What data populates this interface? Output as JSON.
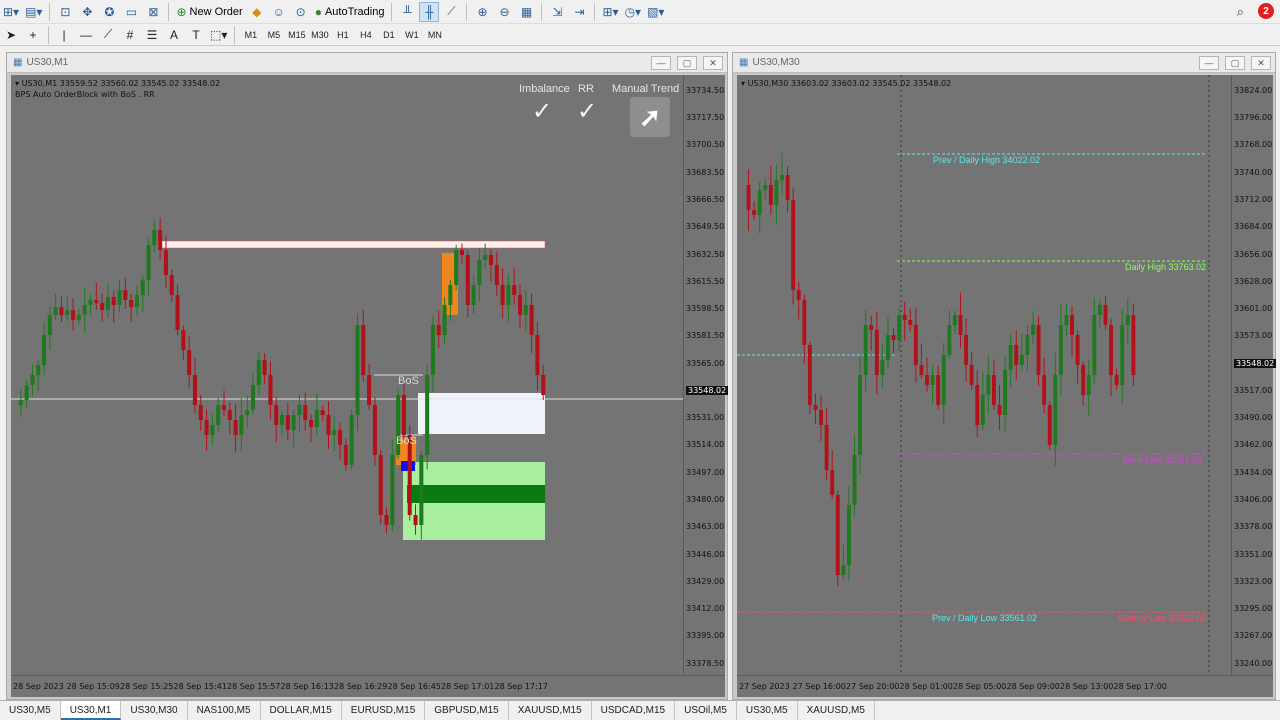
{
  "toolbar": {
    "new_order": "New Order",
    "autotrading": "AutoTrading",
    "timeframes": [
      "M1",
      "M5",
      "M15",
      "M30",
      "H1",
      "H4",
      "D1",
      "W1",
      "MN"
    ],
    "notif_count": "2"
  },
  "left_chart": {
    "window_title": "US30,M1",
    "info": "US30,M1  33559.52 33560.02 33545.02 33548.02",
    "indicator": "BPS Auto OrderBlock with BoS . RR",
    "labels": {
      "imbalance": "Imbalance",
      "rr": "RR",
      "manual_trend": "Manual Trend",
      "bos1": "BoS",
      "bos2": "BoS"
    },
    "price_ticks": [
      "33734.50",
      "33717.50",
      "33700.50",
      "33683.50",
      "33666.50",
      "33649.50",
      "33632.50",
      "33615.50",
      "33598.50",
      "33581.50",
      "33565.00",
      "33548.02",
      "33531.00",
      "33514.00",
      "33497.00",
      "33480.00",
      "33463.00",
      "33446.00",
      "33429.00",
      "33412.00",
      "33395.00",
      "33378.50"
    ],
    "current_price": "33548.02",
    "time_ticks": [
      "28 Sep 2023",
      "28 Sep 15:09",
      "28 Sep 15:25",
      "28 Sep 15:41",
      "28 Sep 15:57",
      "28 Sep 16:13",
      "28 Sep 16:29",
      "28 Sep 16:45",
      "28 Sep 17:01",
      "28 Sep 17:17"
    ]
  },
  "right_chart": {
    "window_title": "US30,M30",
    "info": "US30,M30  33603.02 33603.02 33545.02 33548.02",
    "price_ticks": [
      "33824.00",
      "33796.00",
      "33768.00",
      "33740.00",
      "33712.00",
      "33684.00",
      "33656.00",
      "33628.00",
      "33601.00",
      "33573.00",
      "33548.02",
      "33517.00",
      "33490.00",
      "33462.00",
      "33434.00",
      "33406.00",
      "33378.00",
      "33351.00",
      "33323.00",
      "33295.00",
      "33267.00",
      "33240.00"
    ],
    "current_price": "33548.02",
    "time_ticks": [
      "27 Sep 2023",
      "27 Sep 16:00",
      "27 Sep 20:00",
      "28 Sep 01:00",
      "28 Sep 05:00",
      "28 Sep 09:00",
      "28 Sep 13:00",
      "28 Sep 17:00"
    ],
    "levels": {
      "prev_daily_high": "Prev / Daily High 34022.02",
      "daily_high": "Daily High 33763.02",
      "daily_low": "Daily Low 33561.02",
      "prev_daily_low": "Prev / Daily Low 33561.02",
      "weekly_low": "Weekly Low 33420.02"
    }
  },
  "tabs": [
    "US30,M5",
    "US30,M1",
    "US30,M30",
    "NAS100,M5",
    "DOLLAR,M15",
    "EURUSD,M15",
    "GBPUSD,M15",
    "XAUUSD,M15",
    "USDCAD,M15",
    "USOil,M5",
    "US30,M5",
    "XAUUSD,M5"
  ],
  "colors": {
    "bull": "#1f7a1f",
    "bear": "#b3111a",
    "bg": "#747474",
    "zone_white": "#eef3fb",
    "zone_green": "#a8f0a0",
    "zone_dark_green": "#0a7a12",
    "orange": "#f0861e"
  }
}
